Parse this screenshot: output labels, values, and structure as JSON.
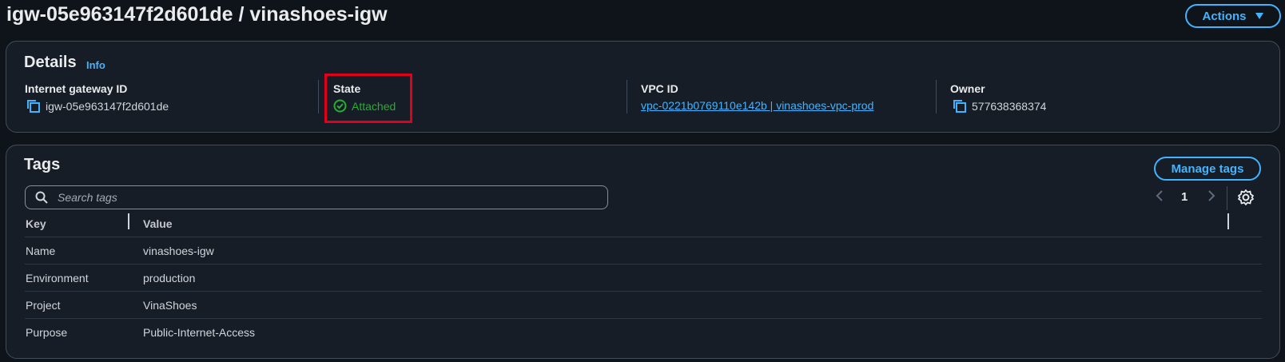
{
  "header": {
    "title": "igw-05e963147f2d601de / vinashoes-igw",
    "actions_label": "Actions"
  },
  "details": {
    "heading": "Details",
    "info_label": "Info",
    "fields": {
      "igw": {
        "label": "Internet gateway ID",
        "value": "igw-05e963147f2d601de"
      },
      "state": {
        "label": "State",
        "value": "Attached"
      },
      "vpc": {
        "label": "VPC ID",
        "value": "vpc-0221b0769110e142b | vinashoes-vpc-prod"
      },
      "owner": {
        "label": "Owner",
        "value": "577638368374"
      }
    }
  },
  "tags": {
    "heading": "Tags",
    "manage_label": "Manage tags",
    "search_placeholder": "Search tags",
    "current_page": "1",
    "columns": [
      "Key",
      "Value"
    ],
    "rows": [
      {
        "key": "Name",
        "value": "vinashoes-igw"
      },
      {
        "key": "Environment",
        "value": "production"
      },
      {
        "key": "Project",
        "value": "VinaShoes"
      },
      {
        "key": "Purpose",
        "value": "Public-Internet-Access"
      }
    ]
  },
  "colors": {
    "accent": "#42b4ff",
    "success": "#29ad32",
    "highlight": "#e0001b",
    "background": "#0f141a",
    "panel": "#161d26"
  },
  "icons": [
    "copy-icon",
    "check-circle-icon",
    "search-icon",
    "chevron-left-icon",
    "chevron-right-icon",
    "settings-icon",
    "caret-down-icon"
  ]
}
